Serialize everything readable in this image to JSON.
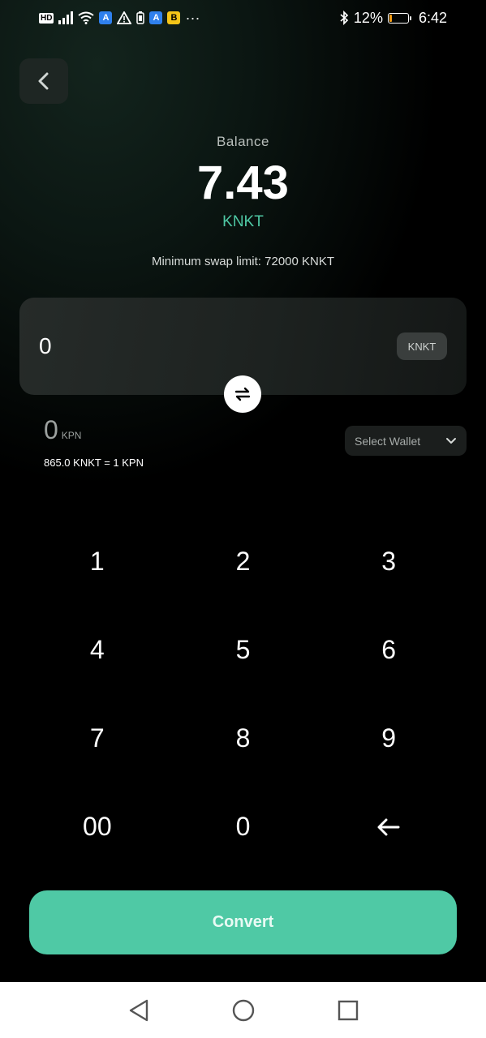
{
  "status_bar": {
    "hd": "HD",
    "app_icon_1": "A",
    "app_icon_2": "A",
    "app_icon_3": "B",
    "more": "···",
    "battery_percent": "12%",
    "battery_level": 0.12,
    "time": "6:42",
    "icons": [
      "hd-icon",
      "signal-icon",
      "wifi-icon",
      "app-icon",
      "warning-icon",
      "battery-saver-icon",
      "app-icon",
      "app-icon",
      "bluetooth-icon",
      "battery-icon"
    ]
  },
  "header": {
    "back_icon": "chevron-left-icon"
  },
  "balance": {
    "label": "Balance",
    "value": "7.43",
    "unit": "KNKT",
    "min_limit": "Minimum swap limit: 72000 KNKT"
  },
  "input": {
    "amount": "0",
    "token": "KNKT"
  },
  "swap_icon": "swap-arrows-icon",
  "output": {
    "amount": "0",
    "unit": "KPN",
    "rate": "865.0 KNKT = 1 KPN"
  },
  "wallet_select": {
    "label": "Select Wallet",
    "icon": "chevron-down-icon"
  },
  "keypad": {
    "keys": [
      "1",
      "2",
      "3",
      "4",
      "5",
      "6",
      "7",
      "8",
      "9",
      "00",
      "0",
      "←"
    ]
  },
  "convert": {
    "label": "Convert"
  },
  "colors": {
    "accent": "#4fc9a5",
    "background": "#000000",
    "card": "#262b29"
  }
}
